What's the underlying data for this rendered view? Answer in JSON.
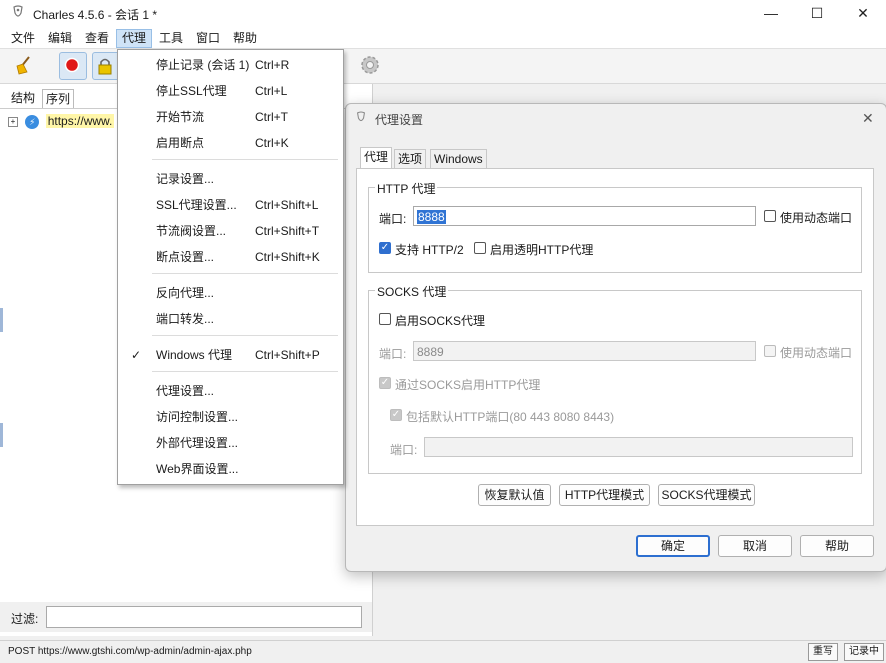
{
  "window": {
    "title": "Charles 4.5.6 - 会话 1 *",
    "minimize_glyph": "—",
    "maximize_glyph": "☐",
    "close_glyph": "✕"
  },
  "menubar": [
    "文件",
    "编辑",
    "查看",
    "代理",
    "工具",
    "窗口",
    "帮助"
  ],
  "left_panel": {
    "tabs": [
      "结构",
      "序列"
    ],
    "tree_item": "https://www.",
    "filter_label": "过滤:"
  },
  "dropdown": {
    "items": [
      {
        "label": "停止记录 (会话 1)",
        "shortcut": "Ctrl+R"
      },
      {
        "label": "停止SSL代理",
        "shortcut": "Ctrl+L"
      },
      {
        "label": "开始节流",
        "shortcut": "Ctrl+T"
      },
      {
        "label": "启用断点",
        "shortcut": "Ctrl+K"
      },
      {
        "label": "记录设置...",
        "shortcut": ""
      },
      {
        "label": "SSL代理设置...",
        "shortcut": "Ctrl+Shift+L"
      },
      {
        "label": "节流阀设置...",
        "shortcut": "Ctrl+Shift+T"
      },
      {
        "label": "断点设置...",
        "shortcut": "Ctrl+Shift+K"
      },
      {
        "label": "反向代理...",
        "shortcut": ""
      },
      {
        "label": "端口转发...",
        "shortcut": ""
      },
      {
        "label": "Windows 代理",
        "shortcut": "Ctrl+Shift+P",
        "checked": true
      },
      {
        "label": "代理设置...",
        "shortcut": ""
      },
      {
        "label": "访问控制设置...",
        "shortcut": ""
      },
      {
        "label": "外部代理设置...",
        "shortcut": ""
      },
      {
        "label": "Web界面设置...",
        "shortcut": ""
      }
    ]
  },
  "dialog": {
    "title": "代理设置",
    "tabs": [
      "代理",
      "选项",
      "Windows"
    ],
    "http": {
      "title": "HTTP 代理",
      "port_label": "端口:",
      "port_value": "8888",
      "dynamic_port": "使用动态端口",
      "http2": "支持 HTTP/2",
      "transparent": "启用透明HTTP代理"
    },
    "socks": {
      "title": "SOCKS 代理",
      "enable": "启用SOCKS代理",
      "port_label": "端口:",
      "port_value": "8889",
      "dynamic_port": "使用动态端口",
      "http_over_socks": "通过SOCKS启用HTTP代理",
      "include_default": "包括默认HTTP端口(80 443 8080 8443)",
      "ports_label": "端口:",
      "ports_value": ""
    },
    "mode_buttons": [
      "恢复默认值",
      "HTTP代理模式",
      "SOCKS代理模式"
    ],
    "ok": "确定",
    "cancel": "取消",
    "help": "帮助"
  },
  "statusbar": {
    "text": "POST https://www.gtshi.com/wp-admin/admin-ajax.php",
    "btn1": "重写",
    "btn2": "记录中"
  },
  "colors": {
    "accent": "#2f6fcf",
    "menu_highlight": "#cfe3f7",
    "tree_highlight": "#fff6a8"
  }
}
